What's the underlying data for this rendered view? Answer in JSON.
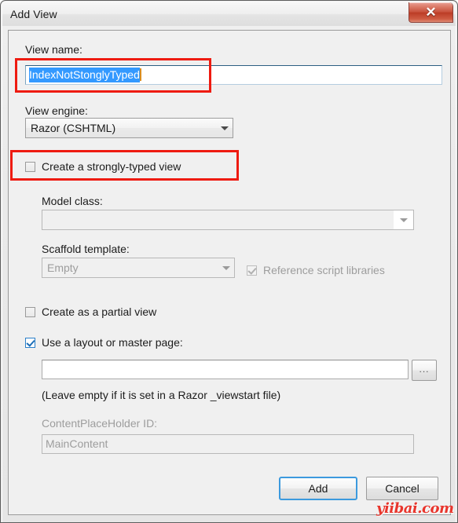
{
  "window": {
    "title": "Add View",
    "close_icon": "close-icon",
    "close_glyph": "✕"
  },
  "form": {
    "view_name_label": "View name:",
    "view_name_value": "IndexNotStonglyTyped",
    "view_engine_label": "View engine:",
    "view_engine_value": "Razor (CSHTML)",
    "strongly_typed_label": "Create a strongly-typed view",
    "model_class_label": "Model class:",
    "model_class_value": "",
    "scaffold_label": "Scaffold template:",
    "scaffold_value": "Empty",
    "reference_scripts_label": "Reference script libraries",
    "partial_view_label": "Create as a partial view",
    "layout_label": "Use a layout or master page:",
    "layout_value": "",
    "browse_label": "...",
    "layout_hint": "(Leave empty if it is set in a Razor _viewstart file)",
    "placeholder_label": "ContentPlaceHolder ID:",
    "placeholder_value": "MainContent"
  },
  "buttons": {
    "add_label": "Add",
    "cancel_label": "Cancel"
  },
  "watermark": {
    "text": "yiibai.com"
  },
  "colors": {
    "accent_blue": "#3399ff",
    "annotation_red": "#ee1b11",
    "close_red": "#c8503b",
    "default_button_border": "#3c9ade",
    "watermark_red": "#e8352c"
  }
}
